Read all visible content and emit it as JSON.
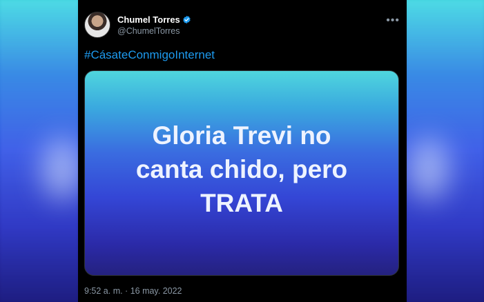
{
  "tweet": {
    "display_name": "Chumel Torres",
    "handle": "@ChumelTorres",
    "hashtag": "#CásateConmigoInternet",
    "media_text_lines": [
      "Gloria Trevi no",
      "canta chido, pero",
      "TRATA"
    ],
    "timestamp": "9:52 a. m. · 16 may. 2022",
    "more_icon": "more-horizontal-icon",
    "verified_icon": "verified-badge-icon"
  },
  "colors": {
    "background": "#000000",
    "link": "#1d9bf0",
    "verified": "#1d9bf0",
    "secondary_text": "#8b98a5"
  }
}
